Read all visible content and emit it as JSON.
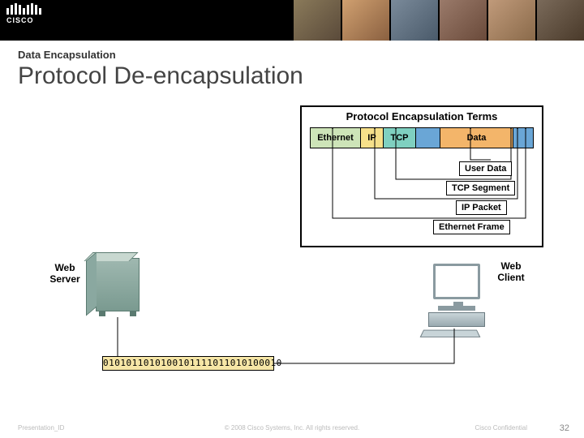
{
  "logo_text": "CISCO",
  "breadcrumb": "Data Encapsulation",
  "title": "Protocol De-encapsulation",
  "terms": {
    "box_title": "Protocol Encapsulation Terms",
    "segments": {
      "eth": "Ethernet",
      "ip": "IP",
      "tcp": "TCP",
      "data": "Data"
    },
    "labels": {
      "user": "User Data",
      "tcpseg": "TCP Segment",
      "ippkt": "IP Packet",
      "ethfrm": "Ethernet Frame"
    }
  },
  "server_label": "Web\nServer",
  "client_label": "Web\nClient",
  "bitstream": "0101011010100101111011010100010",
  "footer": {
    "id": "Presentation_ID",
    "copyright": "© 2008 Cisco Systems, Inc. All rights reserved.",
    "confidential": "Cisco Confidential",
    "page": "32"
  }
}
